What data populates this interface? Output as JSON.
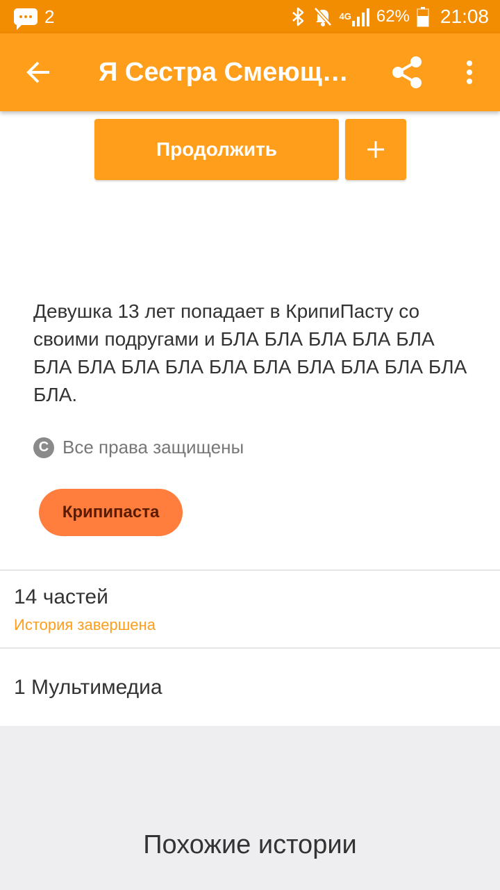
{
  "status_bar": {
    "notification_count": "2",
    "network": "4G",
    "battery_percent": "62%",
    "time": "21:08",
    "icons": [
      "message-icon",
      "bluetooth-icon",
      "notifications-off-icon",
      "signal-icon",
      "battery-icon"
    ]
  },
  "app_bar": {
    "title": "Я Сестра Смеющ…",
    "icons": [
      "back-arrow-icon",
      "share-icon",
      "more-vertical-icon"
    ]
  },
  "actions": {
    "continue_label": "Продолжить",
    "add_label": "+"
  },
  "story": {
    "description": "Девушка 13 лет попадает в КрипиПасту со своими подругами и БЛА БЛА БЛА БЛА БЛА БЛА БЛА БЛА БЛА БЛА БЛА БЛА БЛА БЛА БЛА БЛА.",
    "copyright_symbol": "C",
    "rights": "Все права защищены",
    "tag": "Крипипаста"
  },
  "parts": {
    "count": "14 частей",
    "status": "История завершена"
  },
  "media": {
    "label": "1 Мультимедиа"
  },
  "similar": {
    "title": "Похожие истории"
  },
  "colors": {
    "status_bar": "#f28c00",
    "app_bar": "#ff9e1b",
    "tag": "#ff7e3d",
    "accent_text": "#ff9e1b"
  }
}
